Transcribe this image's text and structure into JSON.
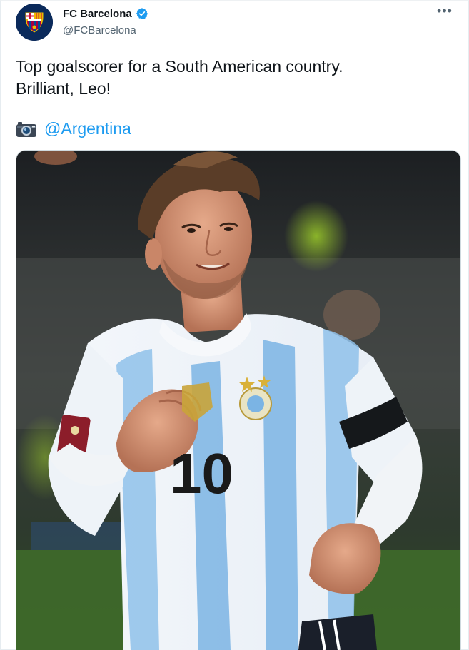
{
  "tweet": {
    "author": {
      "display_name": "FC Barcelona",
      "handle": "@FCBarcelona",
      "verified": true,
      "avatar_icon": "fc-barcelona-crest-icon"
    },
    "more_label": "•••",
    "text_lines": [
      "Top goalscorer for a South American country.",
      "Brilliant, Leo!"
    ],
    "photo_credit": {
      "icon": "camera-icon",
      "mention": "@Argentina"
    },
    "media": {
      "description_icon": "player-celebration-photo",
      "jersey_number": "10"
    }
  },
  "colors": {
    "link": "#1d9bf0",
    "verified": "#1d9bf0",
    "secondary_text": "#536471",
    "crest_blue": "#0b2a5b",
    "crest_red": "#a50044"
  }
}
